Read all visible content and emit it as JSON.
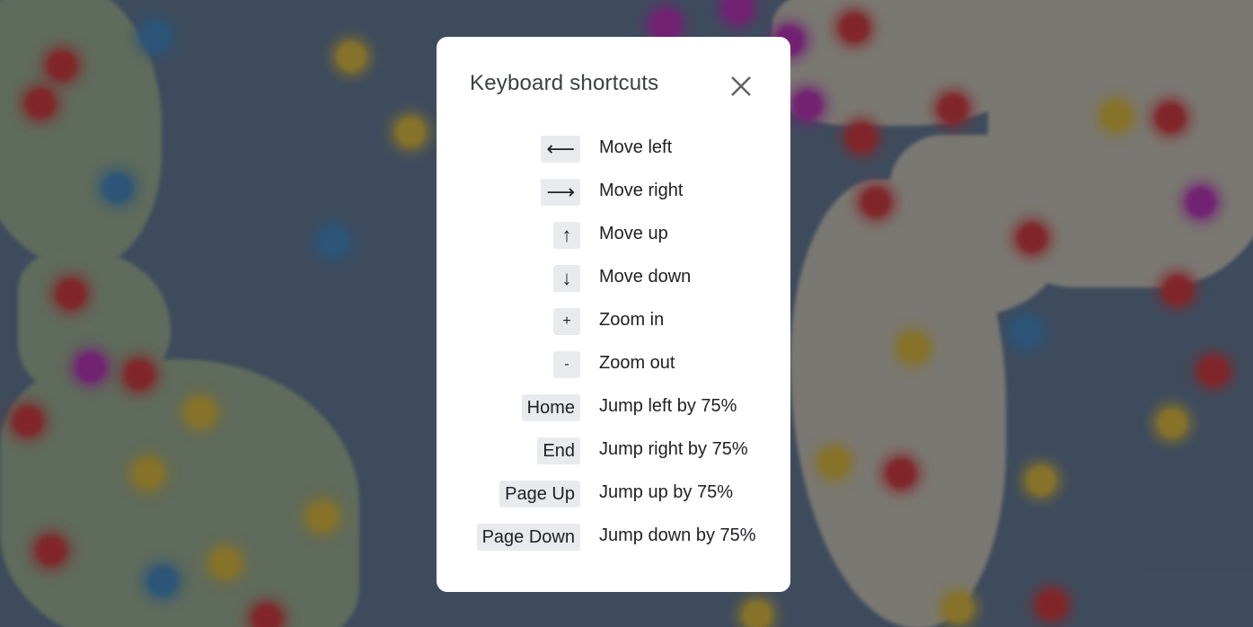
{
  "dialog": {
    "title": "Keyboard shortcuts",
    "close_icon": "close-icon"
  },
  "shortcuts": [
    {
      "key": "⟵",
      "action": "Move left"
    },
    {
      "key": "⟶",
      "action": "Move right"
    },
    {
      "key": "↑",
      "action": "Move up"
    },
    {
      "key": "↓",
      "action": "Move down"
    },
    {
      "key": "+",
      "action": "Zoom in"
    },
    {
      "key": "-",
      "action": "Zoom out"
    },
    {
      "key": "Home",
      "action": "Jump left by 75%"
    },
    {
      "key": "End",
      "action": "Jump right by 75%"
    },
    {
      "key": "Page Up",
      "action": "Jump up by 75%"
    },
    {
      "key": "Page Down",
      "action": "Jump down by 75%"
    }
  ],
  "colors": {
    "overlay": "#4a5f7a",
    "dialog_bg": "#ffffff",
    "key_bg": "#e8eaed",
    "cluster_red": "#b0262b",
    "cluster_yellow": "#b89a2a",
    "cluster_blue": "#2e6ea3",
    "cluster_purple": "#9a1f9a"
  }
}
